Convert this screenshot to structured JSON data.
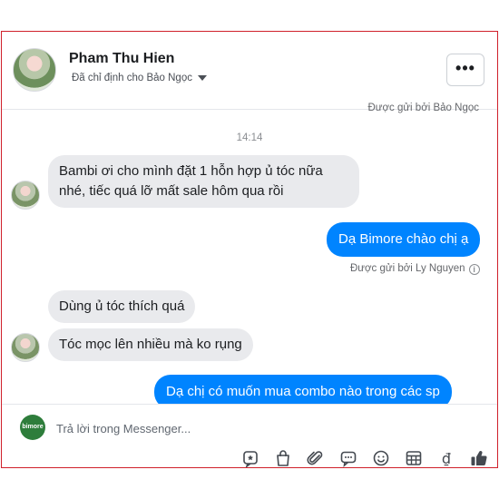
{
  "header": {
    "name": "Pham Thu Hien",
    "assigned": "Đã chỉ định cho Bảo Ngọc",
    "more": "•••"
  },
  "thread": {
    "clipped_note": "Được gửi bởi Bảo Ngọc",
    "time": "14:14",
    "msg1": "Bambi ơi cho mình đặt 1 hỗn hợp ủ tóc nữa nhé, tiếc quá lỡ mất sale hôm qua rồi",
    "msg2": "Dạ Bimore chào chị ạ",
    "sent_by": "Được gửi bởi Ly Nguyen",
    "msg3": "Dùng ủ tóc thích quá",
    "msg4": "Tóc mọc lên nhiều mà ko rụng",
    "msg5": "Dạ chị có muốn mua combo nào trong các sp"
  },
  "composer": {
    "placeholder": "Trả lời trong Messenger...",
    "logo_text": "bimore"
  },
  "icons": [
    "sticker-icon",
    "bag-icon",
    "attach-icon",
    "quick-reply-icon",
    "emoji-icon",
    "calendar-icon",
    "currency-icon",
    "like-icon"
  ],
  "colors": {
    "accent": "#0084ff",
    "incoming": "#e9eaed",
    "border": "#d0202a"
  }
}
